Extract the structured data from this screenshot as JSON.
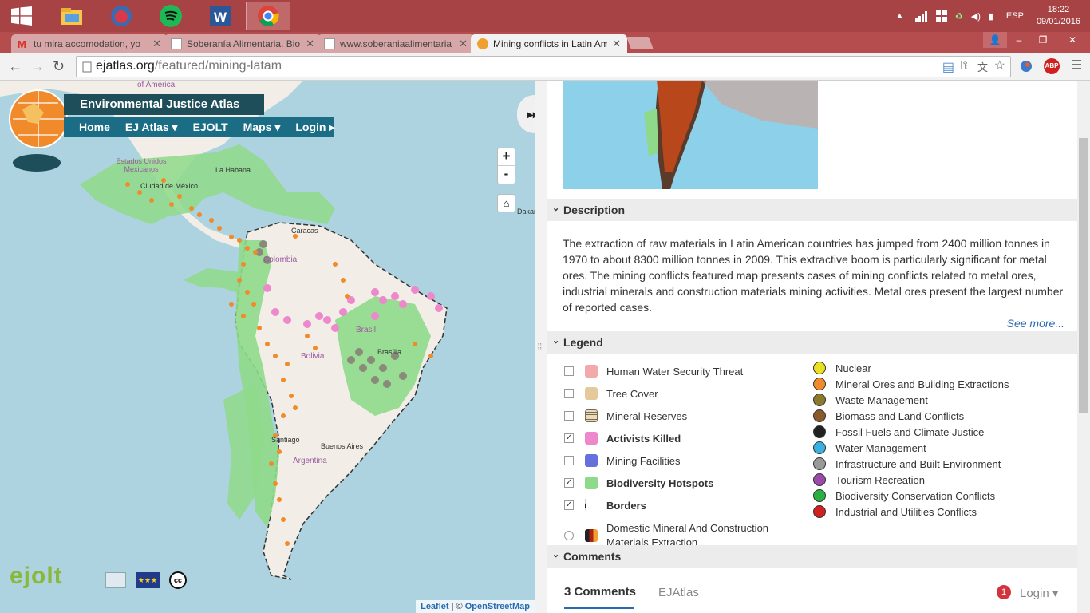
{
  "taskbar": {
    "language": "ESP",
    "time": "18:22",
    "date": "09/01/2016"
  },
  "tabs": [
    {
      "label": "tu mira accomodation, yo",
      "icon": "gmail-icon"
    },
    {
      "label": "Soberanía Alimentaria. Bio",
      "icon": "page-icon"
    },
    {
      "label": "www.soberaniaalimentaria",
      "icon": "page-icon"
    },
    {
      "label": "Mining conflicts in Latin Am",
      "icon": "globe-icon"
    }
  ],
  "address": {
    "domain": "ejatlas.org",
    "path": "/featured/mining-latam"
  },
  "site": {
    "title": "Environmental Justice Atlas",
    "nav": [
      "Home",
      "EJ Atlas ▾",
      "EJOLT",
      "Maps ▾",
      "Login ▸"
    ]
  },
  "map": {
    "labels": [
      "of America",
      "Estados Unidos Mexicanos",
      "Ciudad de México",
      "La Habana",
      "Caracas",
      "Colombia",
      "Brasil",
      "Bolivia",
      "Brasília",
      "Santiago",
      "Buenos Aires",
      "Argentina",
      "Dakar"
    ],
    "zoom_in": "+",
    "zoom_out": "-",
    "attribution_leaflet": "Leaflet",
    "attribution_sep": " | © ",
    "attribution_osm": "OpenStreetMap"
  },
  "footer_logo": "ejolt",
  "description": {
    "title": "Description",
    "text": "The extraction of raw materials in Latin American countries has jumped from 2400 million tonnes in 1970 to about 8300 million tonnes in 2009. This extractive boom is particularly significant for metal ores. The mining conflicts featured map presents cases of mining conflicts related to metal ores, industrial minerals and construction materials mining activities. Metal ores present the largest number of reported cases.",
    "see_more": "See more..."
  },
  "legend": {
    "title": "Legend",
    "layers": [
      {
        "label": "Human Water Security Threat",
        "checked": false,
        "color": "#f2a9a9"
      },
      {
        "label": "Tree Cover",
        "checked": false,
        "color": "#e6c99a"
      },
      {
        "label": "Mineral Reserves",
        "checked": false,
        "color": "#e8dcc0"
      },
      {
        "label": "Activists Killed",
        "checked": true,
        "color": "#ee88cc"
      },
      {
        "label": "Mining Facilities",
        "checked": false,
        "color": "#6670dd"
      },
      {
        "label": "Biodiversity Hotspots",
        "checked": true,
        "color": "#8fd98a"
      },
      {
        "label": "Borders",
        "checked": true,
        "color": "#222222"
      },
      {
        "label": "Domestic Mineral And Construction Materials Extraction",
        "checked": false,
        "color": "#b02010"
      }
    ],
    "categories": [
      {
        "label": "Nuclear",
        "color": "#e8e020"
      },
      {
        "label": "Mineral Ores and Building Extractions",
        "color": "#f08a2a"
      },
      {
        "label": "Waste Management",
        "color": "#8a7a2a"
      },
      {
        "label": "Biomass and Land Conflicts",
        "color": "#8a5a2a"
      },
      {
        "label": "Fossil Fuels and Climate Justice",
        "color": "#222222"
      },
      {
        "label": "Water Management",
        "color": "#3ab0e0"
      },
      {
        "label": "Infrastructure and Built Environment",
        "color": "#999999"
      },
      {
        "label": "Tourism Recreation",
        "color": "#9a4aaa"
      },
      {
        "label": "Biodiversity Conservation Conflicts",
        "color": "#2ab040"
      },
      {
        "label": "Industrial and Utilities Conflicts",
        "color": "#d02020"
      }
    ]
  },
  "comments": {
    "title": "Comments",
    "count": "3 Comments",
    "site_tab": "EJAtlas",
    "notif": "1",
    "login": "Login ▾"
  }
}
